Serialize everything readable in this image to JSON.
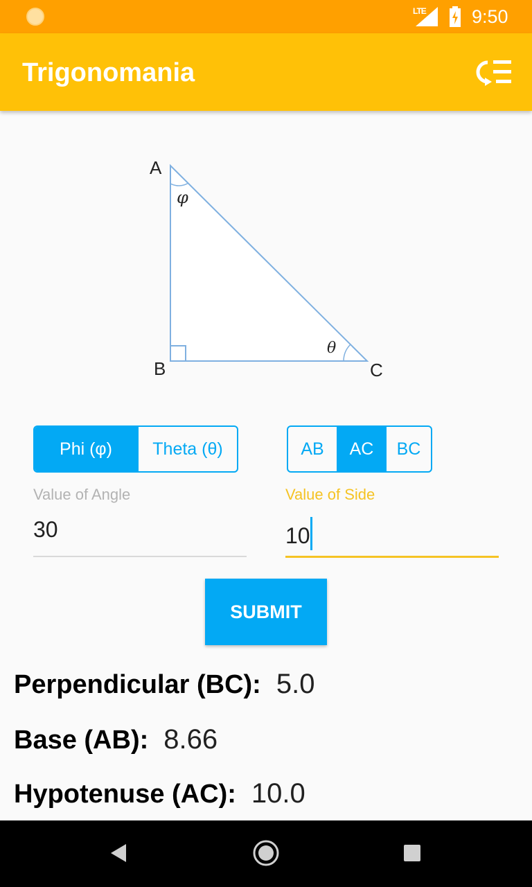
{
  "status_bar": {
    "network": "LTE",
    "time": "9:50"
  },
  "app_bar": {
    "title": "Trigonomania"
  },
  "diagram": {
    "vertex_a": "A",
    "vertex_b": "B",
    "vertex_c": "C",
    "angle_phi": "φ",
    "angle_theta": "θ"
  },
  "angle_selector": {
    "options": [
      "Phi (φ)",
      "Theta (θ)"
    ],
    "selected": "Phi (φ)"
  },
  "side_selector": {
    "options": [
      "AB",
      "AC",
      "BC"
    ],
    "selected": "AC"
  },
  "angle_field": {
    "label": "Value of Angle",
    "value": "30"
  },
  "side_field": {
    "label": "Value of Side",
    "value": "10"
  },
  "submit_label": "SUBMIT",
  "results": [
    {
      "label": "Perpendicular (BC):",
      "value": "5.0"
    },
    {
      "label": "Base (AB):",
      "value": "8.66"
    },
    {
      "label": "Hypotenuse (AC):",
      "value": "10.0"
    }
  ],
  "colors": {
    "status_bar": "#ffa000",
    "app_bar": "#ffc107",
    "accent": "#03a9f4",
    "focus": "#f5c324"
  }
}
